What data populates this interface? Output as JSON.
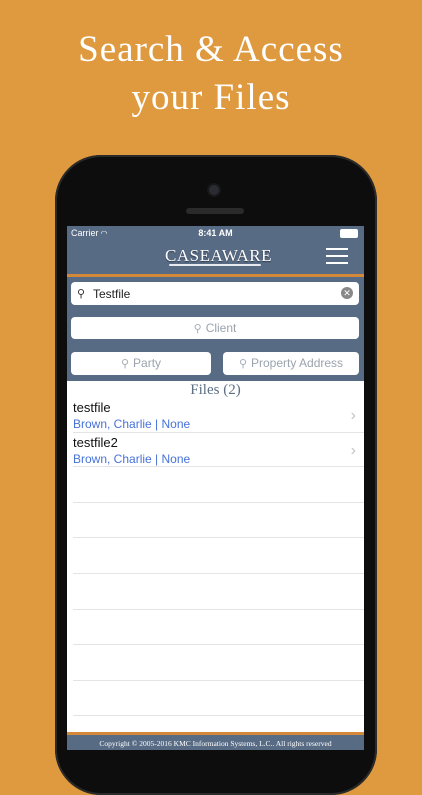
{
  "promo": {
    "line1": "Search & Access",
    "line2": "your Files"
  },
  "status": {
    "carrier": "Carrier",
    "time": "8:41 AM"
  },
  "app": {
    "logo": "CASEAWARE"
  },
  "search": {
    "files_value": "Testfile",
    "client_placeholder": "Client",
    "party_placeholder": "Party",
    "address_placeholder": "Property Address"
  },
  "results": {
    "title": "Files (2)",
    "items": [
      {
        "name": "testfile",
        "meta": "Brown, Charlie | None"
      },
      {
        "name": "testfile2",
        "meta": "Brown, Charlie | None"
      }
    ]
  },
  "footer": {
    "copyright": "Copyright © 2005-2016 KMC Information Systems, L.C.. All rights reserved"
  },
  "colors": {
    "background": "#df9a3f",
    "header": "#586b84",
    "accent": "#d4883a",
    "link": "#4672d8"
  }
}
